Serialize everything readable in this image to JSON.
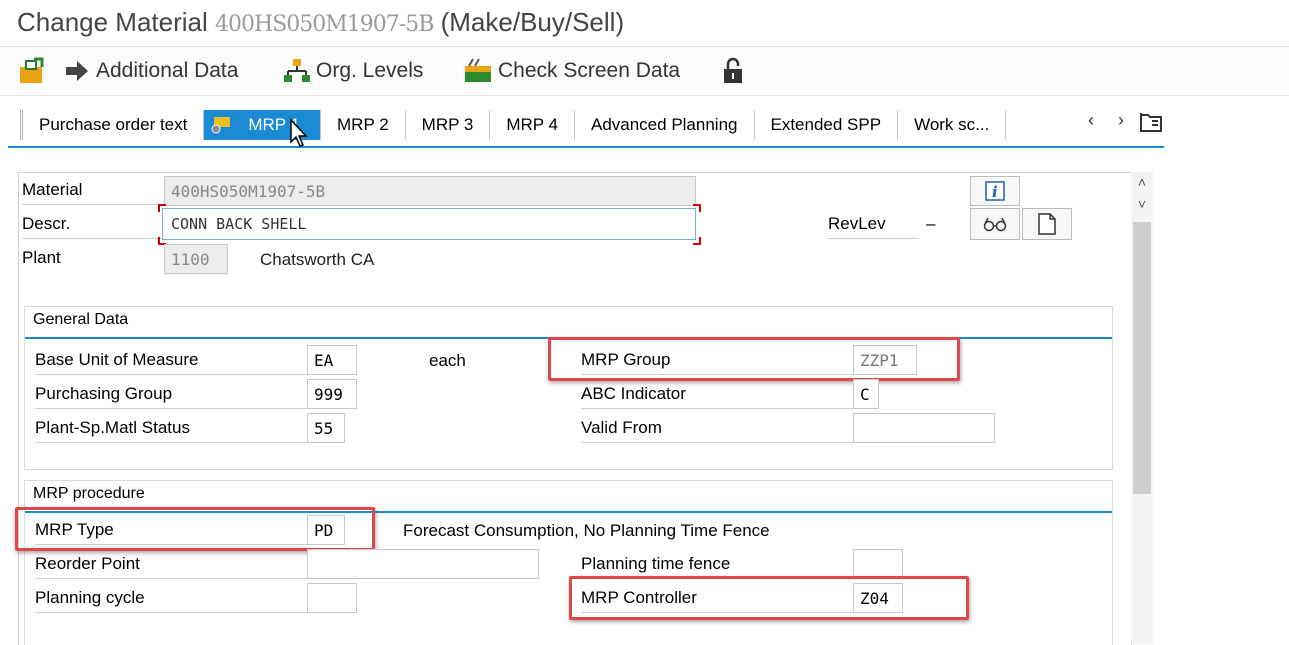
{
  "window": {
    "title_prefix": "Change Material",
    "title_material": "400HS050M1907-5B",
    "title_suffix": "(Make/Buy/Sell)"
  },
  "toolbar": {
    "additional_data": "Additional Data",
    "org_levels": "Org. Levels",
    "check_screen_data": "Check Screen Data"
  },
  "tabs": [
    {
      "label": "Purchase order text",
      "active": false
    },
    {
      "label": "MRP 1",
      "active": true
    },
    {
      "label": "MRP 2",
      "active": false
    },
    {
      "label": "MRP 3",
      "active": false
    },
    {
      "label": "MRP 4",
      "active": false
    },
    {
      "label": "Advanced Planning",
      "active": false
    },
    {
      "label": "Extended SPP",
      "active": false
    },
    {
      "label": "Work sc...",
      "active": false
    }
  ],
  "header": {
    "material_label": "Material",
    "material_value": "400HS050M1907-5B",
    "descr_label": "Descr.",
    "descr_value": "CONN BACK SHELL",
    "plant_label": "Plant",
    "plant_value": "1100",
    "plant_name": "Chatsworth CA",
    "revlev_label": "RevLev",
    "revlev_value": "–"
  },
  "general_data": {
    "title": "General Data",
    "base_uom_label": "Base Unit of Measure",
    "base_uom_value": "EA",
    "base_uom_text": "each",
    "purch_group_label": "Purchasing Group",
    "purch_group_value": "999",
    "status_label": "Plant-Sp.Matl Status",
    "status_value": "55",
    "mrp_group_label": "MRP Group",
    "mrp_group_value": "ZZP1",
    "abc_label": "ABC Indicator",
    "abc_value": "C",
    "valid_from_label": "Valid From",
    "valid_from_value": ""
  },
  "mrp_procedure": {
    "title": "MRP procedure",
    "mrp_type_label": "MRP Type",
    "mrp_type_value": "PD",
    "mrp_type_text": "Forecast Consumption, No Planning Time Fence",
    "reorder_label": "Reorder Point",
    "reorder_value": "",
    "cycle_label": "Planning cycle",
    "cycle_value": "",
    "fence_label": "Planning time fence",
    "fence_value": "",
    "controller_label": "MRP Controller",
    "controller_value": "Z04"
  },
  "colors": {
    "accent": "#1a8ad4",
    "highlight": "#e0464a"
  },
  "icons": [
    "save-edit-icon",
    "arrow-right-icon",
    "org-hierarchy-icon",
    "check-screen-icon",
    "lock-icon",
    "info-icon",
    "glasses-icon",
    "document-icon",
    "chevron-left-icon",
    "chevron-right-icon",
    "tab-list-icon"
  ]
}
